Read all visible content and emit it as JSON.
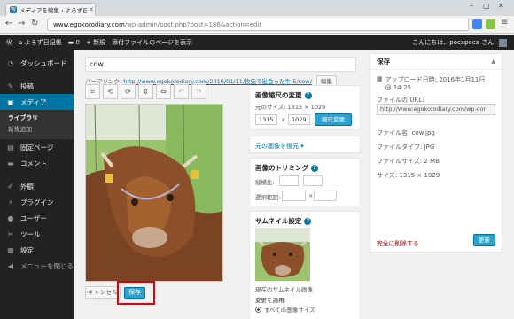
{
  "browser": {
    "tab_title": "メディアを編集 ‹ よろず日記帳",
    "url_host": "www.egokorodiary.com",
    "url_path": "/wp-admin/post.php?post=186&action=edit"
  },
  "adminbar": {
    "site_name": "よろず日記帳",
    "comments_count": "0",
    "new_label": "新規",
    "view_attachment": "添付ファイルのページを表示",
    "greeting": "こんにちは、pocapoca さん!"
  },
  "sidebar": {
    "items": [
      {
        "label": "ダッシュボード",
        "icon": "dashboard-icon"
      },
      {
        "label": "投稿",
        "icon": "pin-icon"
      },
      {
        "label": "メディア",
        "icon": "media-icon"
      },
      {
        "label": "固定ページ",
        "icon": "page-icon"
      },
      {
        "label": "コメント",
        "icon": "comment-icon"
      },
      {
        "label": "外観",
        "icon": "brush-icon"
      },
      {
        "label": "プラグイン",
        "icon": "plugin-icon"
      },
      {
        "label": "ユーザー",
        "icon": "user-icon"
      },
      {
        "label": "ツール",
        "icon": "wrench-icon"
      },
      {
        "label": "設定",
        "icon": "settings-icon"
      },
      {
        "label": "メニューを閉じる",
        "icon": "collapse-icon"
      }
    ],
    "submenu": [
      "ライブラリ",
      "新規追加"
    ]
  },
  "editor": {
    "title_value": "cow",
    "permalink_label": "パーマリンク:",
    "permalink_url": "http://www.egokorodiary.com/2016/01/11/牧先で出会った牛-5/cow/",
    "permalink_edit": "編集",
    "cancel_label": "キャンセル",
    "save_label": "保存"
  },
  "scale_panel": {
    "title": "画像縮尺の変更",
    "original_size": "元のサイズ: 1315 × 1029",
    "width": "1315",
    "height": "1029",
    "x": "×",
    "button": "縮尺変更"
  },
  "restore_panel": {
    "title": "元の画像を復元"
  },
  "crop_panel": {
    "title": "画像のトリミング",
    "aspect_label": "縦横比:",
    "selection_label": "選択範囲:",
    "x": "×"
  },
  "thumb_panel": {
    "title": "サムネイル設定",
    "current_label": "現在のサムネイル画像",
    "apply_label": "変更を適用:",
    "option_all": "すべての画像サイズ"
  },
  "save_box": {
    "title": "保存",
    "upload_date": "アップロード日時: 2016年1月11日 @ 14:25",
    "file_url_label": "ファイルの URL:",
    "file_url": "http://www.egokorodiary.com/wp-cor",
    "file_name": "ファイル名: cow.jpg",
    "file_type": "ファイルタイプ: JPG",
    "file_size": "ファイルサイズ: 2 MB",
    "dimensions": "サイズ: 1315 × 1029",
    "delete_label": "完全に削除する",
    "update_label": "更新"
  }
}
